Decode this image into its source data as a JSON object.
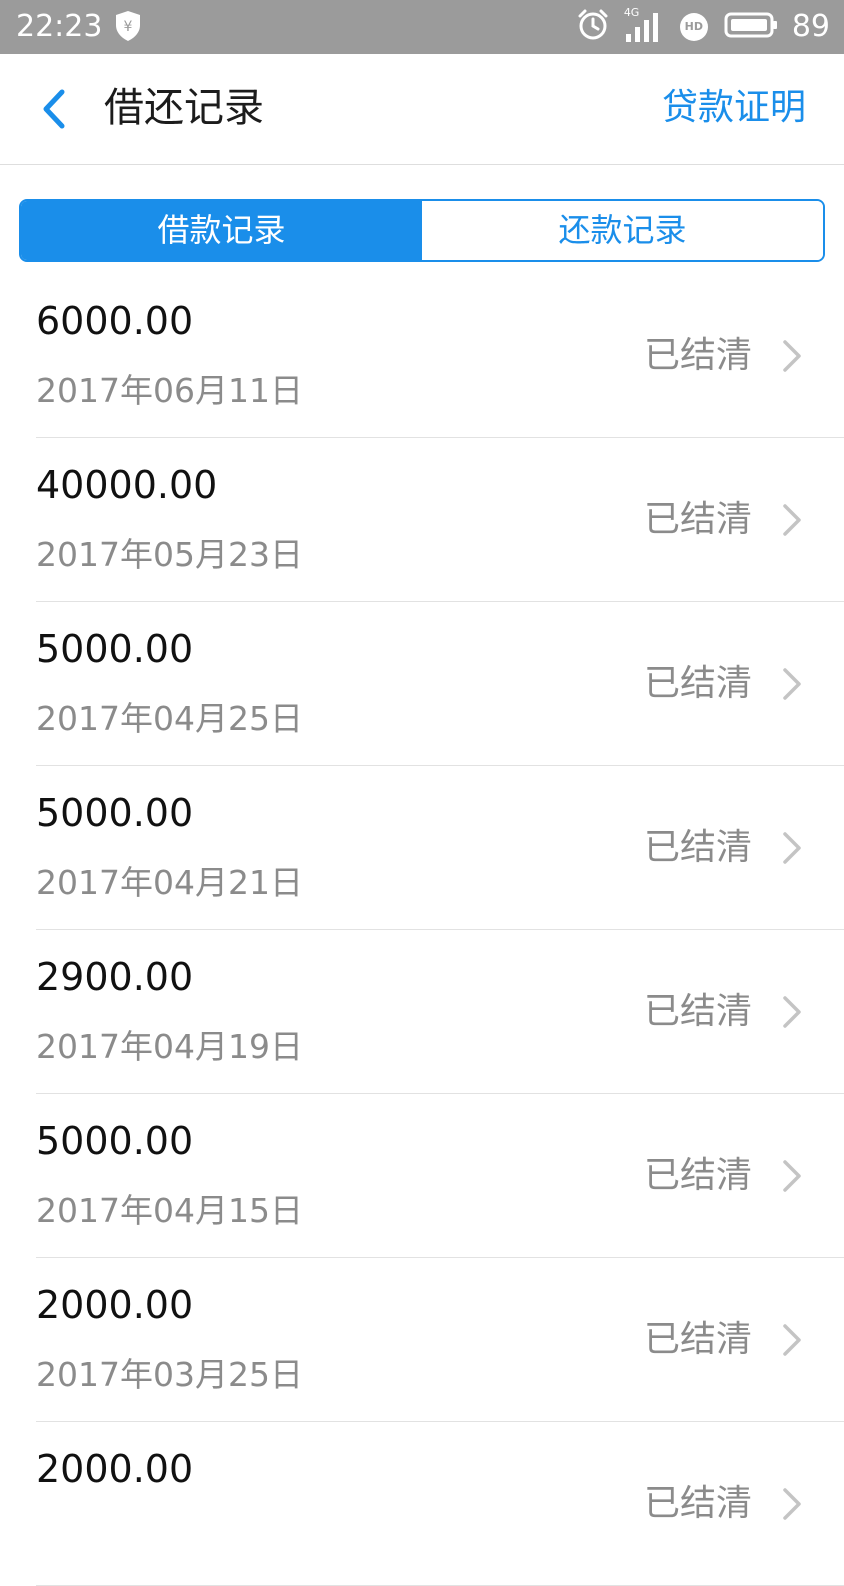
{
  "status_bar": {
    "time": "22:23",
    "network": "4G",
    "hd_badge": "HD",
    "battery": "89",
    "icons": [
      "shield-yen-icon",
      "alarm-icon",
      "signal-icon",
      "hd-icon",
      "battery-icon"
    ]
  },
  "header": {
    "title": "借还记录",
    "action_label": "贷款证明",
    "back_icon": "chevron-left-icon",
    "accent_color": "#1a8eea"
  },
  "tabs": [
    {
      "label": "借款记录",
      "active": true
    },
    {
      "label": "还款记录",
      "active": false
    }
  ],
  "records": [
    {
      "amount": "6000.00",
      "date": "2017年06月11日",
      "status": "已结清"
    },
    {
      "amount": "40000.00",
      "date": "2017年05月23日",
      "status": "已结清"
    },
    {
      "amount": "5000.00",
      "date": "2017年04月25日",
      "status": "已结清"
    },
    {
      "amount": "5000.00",
      "date": "2017年04月21日",
      "status": "已结清"
    },
    {
      "amount": "2900.00",
      "date": "2017年04月19日",
      "status": "已结清"
    },
    {
      "amount": "5000.00",
      "date": "2017年04月15日",
      "status": "已结清"
    },
    {
      "amount": "2000.00",
      "date": "2017年03月25日",
      "status": "已结清"
    },
    {
      "amount": "2000.00",
      "date": "",
      "status": "已结清"
    }
  ]
}
